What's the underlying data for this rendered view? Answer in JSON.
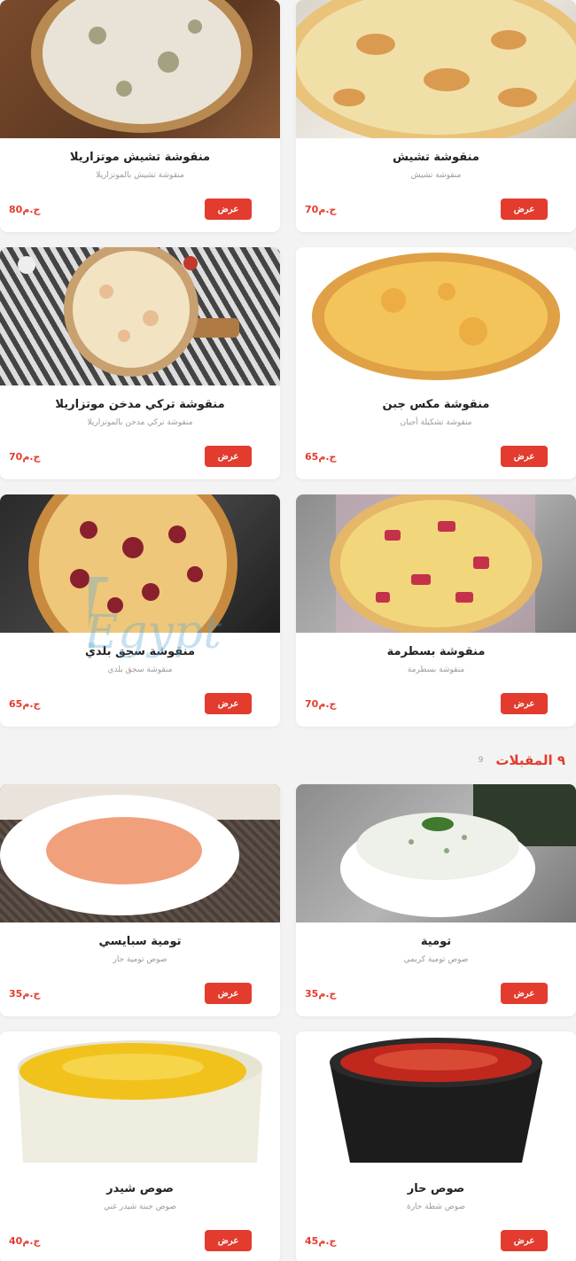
{
  "currency": "ج.م",
  "view_label": "عرض",
  "pizza_items": [
    {
      "name": "منقوشة تشيش",
      "desc": "منقوشة تشيش",
      "price": "70ج.م"
    },
    {
      "name": "منقوشة تشيش موتزاريلا",
      "desc": "منقوشة تشيش بالموتزاريلا",
      "price": "80ج.م"
    },
    {
      "name": "منقوشة مكس جبن",
      "desc": "منقوشة تشكيلة أجبان",
      "price": "65ج.م"
    },
    {
      "name": "منقوشة تركي مدخن موتزاريلا",
      "desc": "منقوشة تركي مدخن بالموتزاريلا",
      "price": "70ج.م"
    },
    {
      "name": "منقوشة بسطرمة",
      "desc": "منقوشة بسطرمة",
      "price": "70ج.م"
    },
    {
      "name": "منقوشة سجق بلدي",
      "desc": "منقوشة سجق بلدي",
      "price": "65ج.م"
    }
  ],
  "section": {
    "title": "المقبلات",
    "count": "9",
    "number": "٩"
  },
  "appetizer_items": [
    {
      "name": "تومية",
      "desc": "صوص تومية كريمي",
      "price": "35ج.م"
    },
    {
      "name": "تومية سبايسي",
      "desc": "صوص تومية حار",
      "price": "35ج.م"
    },
    {
      "name": "صوص حار",
      "desc": "صوص شطة حارة",
      "price": "45ج.م"
    },
    {
      "name": "صوص شيدر",
      "desc": "صوص جبنة شيدر غني",
      "price": "40ج.م"
    }
  ],
  "watermark": "MenuEgypt.com",
  "colors": {
    "accent": "#e33b2e",
    "background": "#f3f3f3",
    "card": "#ffffff"
  }
}
